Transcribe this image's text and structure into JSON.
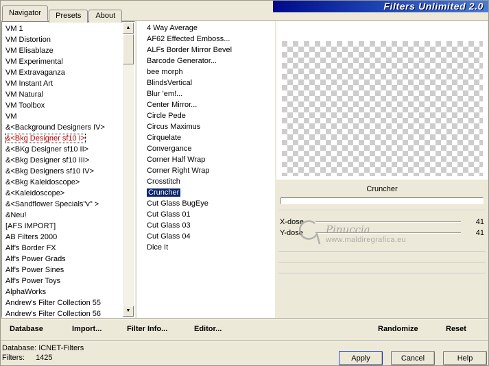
{
  "window": {
    "title": "Filters Unlimited 2.0"
  },
  "tabs": {
    "items": [
      {
        "label": "Navigator",
        "active": true
      },
      {
        "label": "Presets",
        "active": false
      },
      {
        "label": "About",
        "active": false
      }
    ]
  },
  "navigator": {
    "categories": [
      "VM 1",
      "VM Distortion",
      "VM Elisablaze",
      "VM Experimental",
      "VM Extravaganza",
      "VM Instant Art",
      "VM Natural",
      "VM Toolbox",
      "VM",
      "&<Background Designers IV>",
      "&<Bkg Designer sf10 I>",
      "&<BKg Designer sf10 II>",
      "&<Bkg Designer sf10 III>",
      "&<Bkg Designers sf10 IV>",
      "&<Bkg Kaleidoscope>",
      "&<Kaleidoscope>",
      "&<Sandflower Specials\"v\" >",
      "&Neu!",
      "[AFS IMPORT]",
      "AB Filters 2000",
      "Alf's Border FX",
      "Alf's Power Grads",
      "Alf's Power Sines",
      "Alf's Power Toys",
      "AlphaWorks",
      "Andrew's Filter Collection 55",
      "Andrew's Filter Collection 56"
    ],
    "selected_category": "&<Bkg Designer sf10 I>"
  },
  "filters": {
    "items": [
      "4 Way Average",
      "AF62 Effected Emboss...",
      "ALFs Border Mirror Bevel",
      "Barcode Generator...",
      "bee morph",
      "BlindsVertical",
      "Blur 'em!...",
      "Center Mirror...",
      "Circle Pede",
      "Circus Maximus",
      "Cirquelate",
      "Convergance",
      "Corner Half Wrap",
      "Corner Right Wrap",
      "Crosstitch",
      "Cruncher",
      "Cut Glass  BugEye",
      "Cut Glass 01",
      "Cut Glass 03",
      "Cut Glass 04",
      "Dice It"
    ],
    "selected": "Cruncher"
  },
  "controls": {
    "title": "Cruncher",
    "params": [
      {
        "label": "X-dose",
        "value": "41"
      },
      {
        "label": "Y-dose",
        "value": "41"
      }
    ]
  },
  "preview": {
    "watermark_name": "Pinuccia",
    "watermark_url": "www.maldiregrafica.eu"
  },
  "actions": {
    "left": [
      "Database",
      "Import...",
      "Filter Info...",
      "Editor..."
    ],
    "right": [
      "Randomize",
      "Reset"
    ]
  },
  "status": {
    "database_label": "Database:",
    "database_value": "ICNET-Filters",
    "filters_label": "Filters:",
    "filters_value": "1425"
  },
  "dialog_buttons": {
    "apply": "Apply",
    "cancel": "Cancel",
    "help": "Help"
  },
  "colors": {
    "window_bg": "#ece9d8",
    "selection_bg": "#0a246a",
    "selected_category_text": "#b40000",
    "title_gradient_left": "#000a8a",
    "title_gradient_right": "#4a7bd8",
    "checker_light": "#ffffff",
    "checker_dark": "#cdcdcd"
  }
}
